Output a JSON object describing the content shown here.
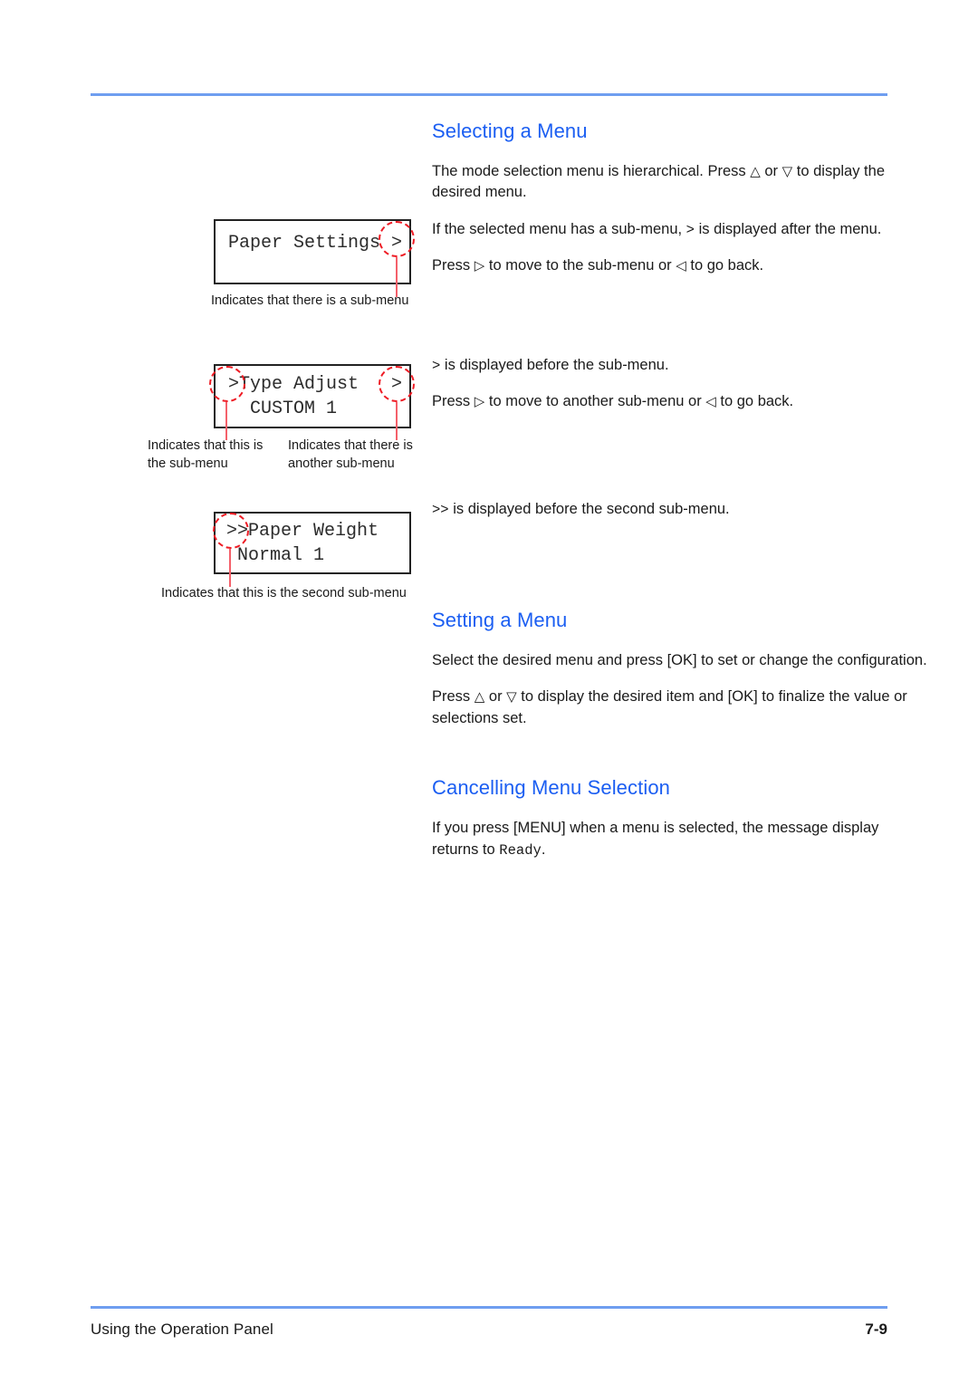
{
  "page": {
    "footer_left": "Using the Operation Panel",
    "page_number": "7-9",
    "rule_color": "#6f9ef0",
    "heading_color": "#1b5ef2",
    "annotation_color": "#ee1b24"
  },
  "sections": {
    "selecting": {
      "heading": "Selecting a Menu",
      "p1_a": "The mode selection menu is hierarchical. Press ",
      "p1_up": "△",
      "p1_b": " or ",
      "p1_down": "▽",
      "p1_c": " to display the desired menu.",
      "p2_a": "If the selected menu has a sub-menu, ",
      "p2_gt": ">",
      "p2_b": " is displayed after the menu.",
      "p3_a": "Press ",
      "p3_right": "▷",
      "p3_b": " to move to the sub-menu or ",
      "p3_left": "◁",
      "p3_c": " to go back.",
      "p4_gt": ">",
      "p4_a": " is displayed before the sub-menu.",
      "p5_a": "Press ",
      "p5_right": "▷",
      "p5_b": " to move to another sub-menu or ",
      "p5_left": "◁",
      "p5_c": " to go back.",
      "p6_gt": ">>",
      "p6_a": " is displayed before the second sub-menu."
    },
    "setting": {
      "heading": "Setting a Menu",
      "p1": "Select the desired menu and press [OK] to set or change the configuration.",
      "p2_a": "Press ",
      "p2_up": "△",
      "p2_b": " or ",
      "p2_down": "▽",
      "p2_c": " to display the desired item and [OK] to finalize the value or selections set."
    },
    "cancelling": {
      "heading": "Cancelling Menu Selection",
      "p1_a": "If you press [MENU] when a menu is selected, the message display returns to ",
      "p1_mono": "Ready",
      "p1_b": "."
    }
  },
  "lcd_panels": [
    {
      "name": "paper-settings",
      "line1": "Paper Settings >",
      "line2": "",
      "captions": [
        "Indicates that there is a sub-menu"
      ]
    },
    {
      "name": "type-adjust",
      "line1": ">Type Adjust   >",
      "line2": "  CUSTOM 1",
      "captions": [
        "Indicates that this is\nthe sub-menu",
        "Indicates that there is\nanother sub-menu"
      ]
    },
    {
      "name": "paper-weight",
      "line1": ">>Paper Weight",
      "line2": " Normal 1",
      "captions": [
        "Indicates that this is the second sub-menu"
      ]
    }
  ]
}
